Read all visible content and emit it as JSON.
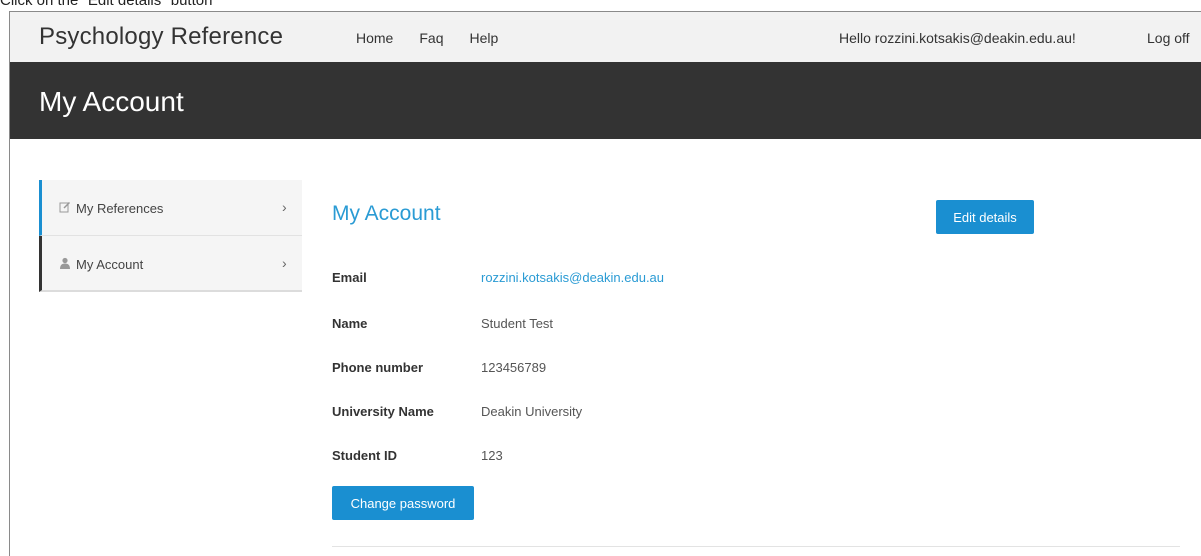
{
  "instruction": "Click on the \"Edit details\" button",
  "topnav": {
    "brand": "Psychology Reference",
    "links": [
      "Home",
      "Faq",
      "Help"
    ],
    "greeting": "Hello rozzini.kotsakis@deakin.edu.au!",
    "logoff": "Log off"
  },
  "header": {
    "title": "My Account"
  },
  "sidebar": {
    "items": [
      {
        "label": "My References",
        "icon": "edit-icon"
      },
      {
        "label": "My Account",
        "icon": "user-icon"
      }
    ]
  },
  "main": {
    "title": "My Account",
    "edit_label": "Edit details",
    "fields": [
      {
        "label": "Email",
        "value": "rozzini.kotsakis@deakin.edu.au"
      },
      {
        "label": "Name",
        "value": "Student Test"
      },
      {
        "label": "Phone number",
        "value": "123456789"
      },
      {
        "label": "University Name",
        "value": "Deakin University"
      },
      {
        "label": "Student ID",
        "value": "123"
      }
    ],
    "change_password_label": "Change password"
  },
  "colors": {
    "accent": "#1a8fd1",
    "header_bg": "#333333",
    "nav_bg": "#f2f2f2"
  }
}
